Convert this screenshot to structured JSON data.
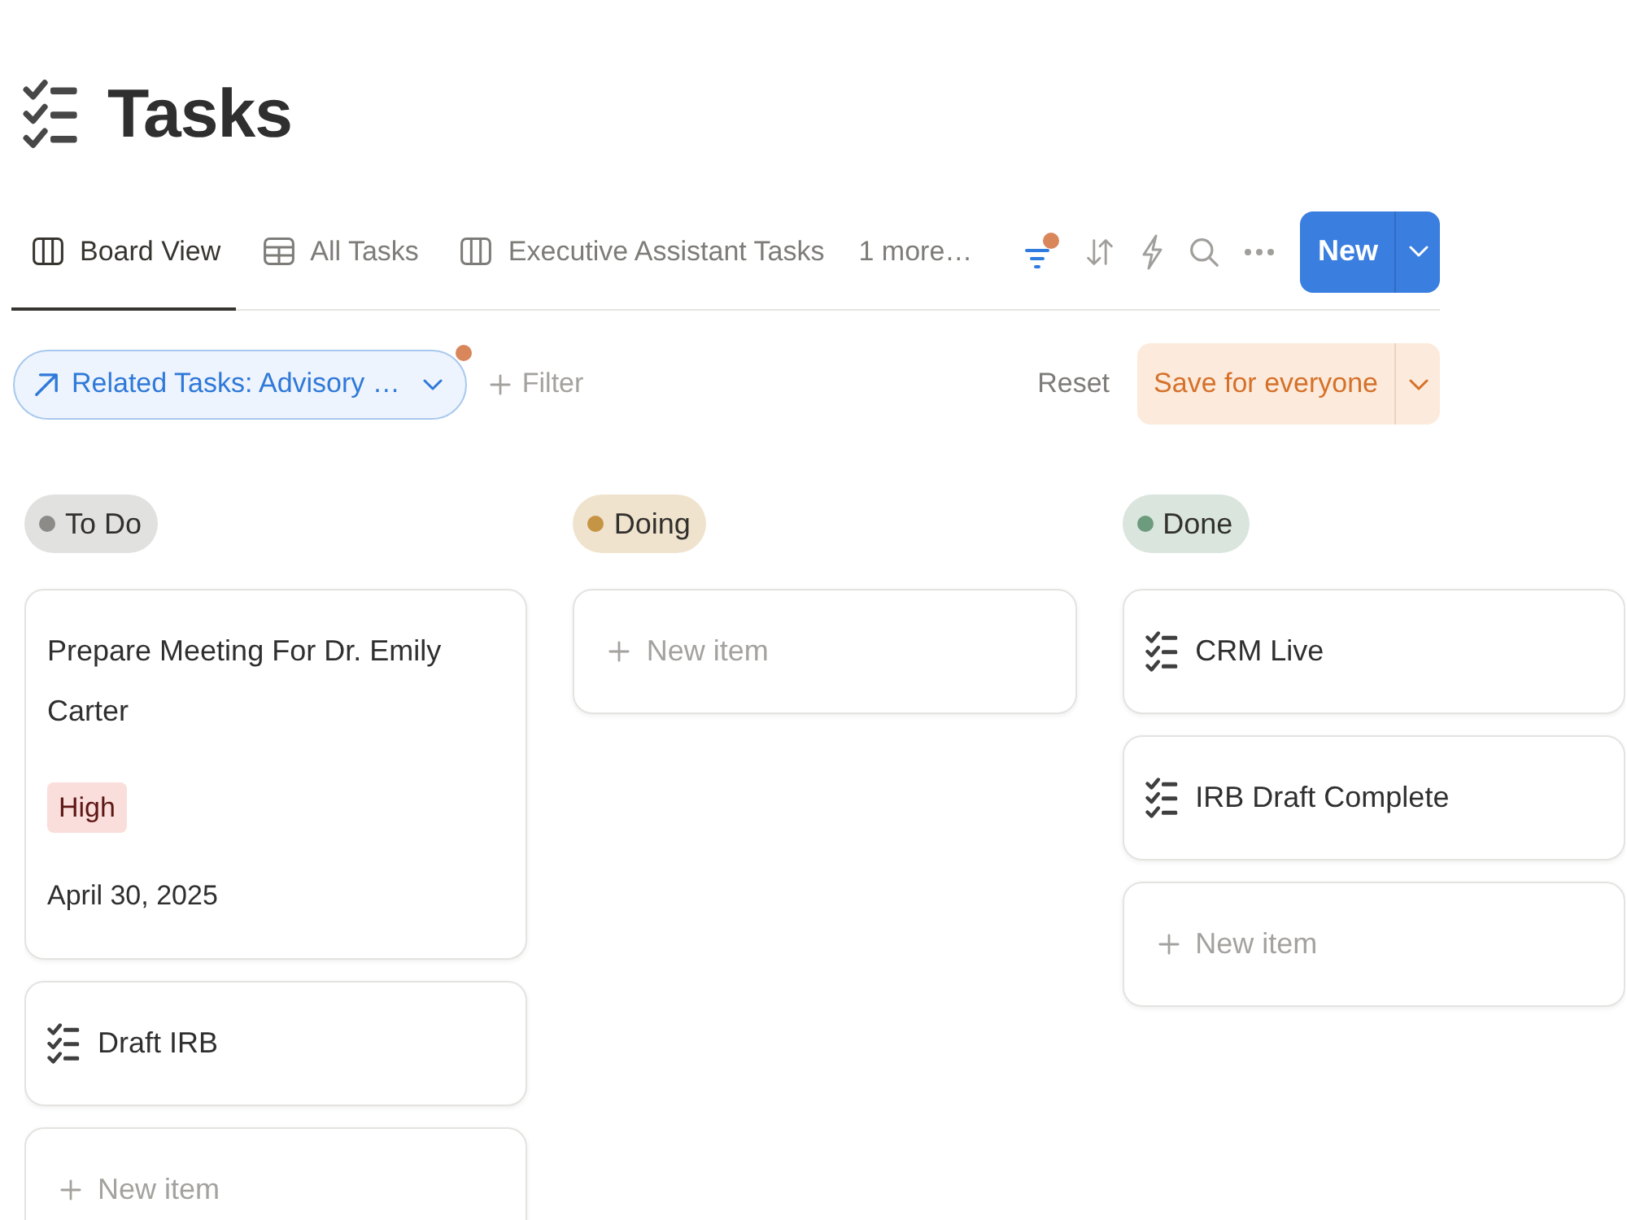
{
  "header": {
    "title": "Tasks"
  },
  "tabs": [
    {
      "label": "Board View",
      "kind": "board",
      "selected": true
    },
    {
      "label": "All Tasks",
      "kind": "table",
      "selected": false
    },
    {
      "label": "Executive Assistant Tasks",
      "kind": "board",
      "selected": false
    }
  ],
  "more_views": "1 more…",
  "toolbar": [
    {
      "kind": "filter",
      "active": true
    },
    {
      "kind": "sort",
      "active": false
    },
    {
      "kind": "automation",
      "active": false
    },
    {
      "kind": "search",
      "active": false
    },
    {
      "kind": "more",
      "active": false
    }
  ],
  "new_button": {
    "label": "New"
  },
  "filter_bar": {
    "filters": [
      {
        "label": "Related Tasks: Advisory …",
        "modified": true
      }
    ],
    "add_filter": "Filter",
    "reset": "Reset",
    "save": "Save for everyone"
  },
  "columns": [
    {
      "name": "To Do",
      "color": "#8c8b87",
      "cards": [
        {
          "title": "Prepare Meeting For Dr. Emily Carter",
          "has_icon": false,
          "tags": [
            {
              "label": "High",
              "color": "#fadedb"
            }
          ],
          "date": "April 30, 2025"
        },
        {
          "title": "Draft IRB",
          "has_icon": true
        }
      ],
      "new_item": "New item"
    },
    {
      "name": "Doing",
      "color": "#c59444",
      "new_item": "New item"
    },
    {
      "name": "Done",
      "color": "#6c9b7d",
      "cards": [
        {
          "title": "CRM Live",
          "has_icon": true
        },
        {
          "title": "IRB Draft Complete",
          "has_icon": true
        }
      ],
      "new_item": "New item"
    }
  ]
}
